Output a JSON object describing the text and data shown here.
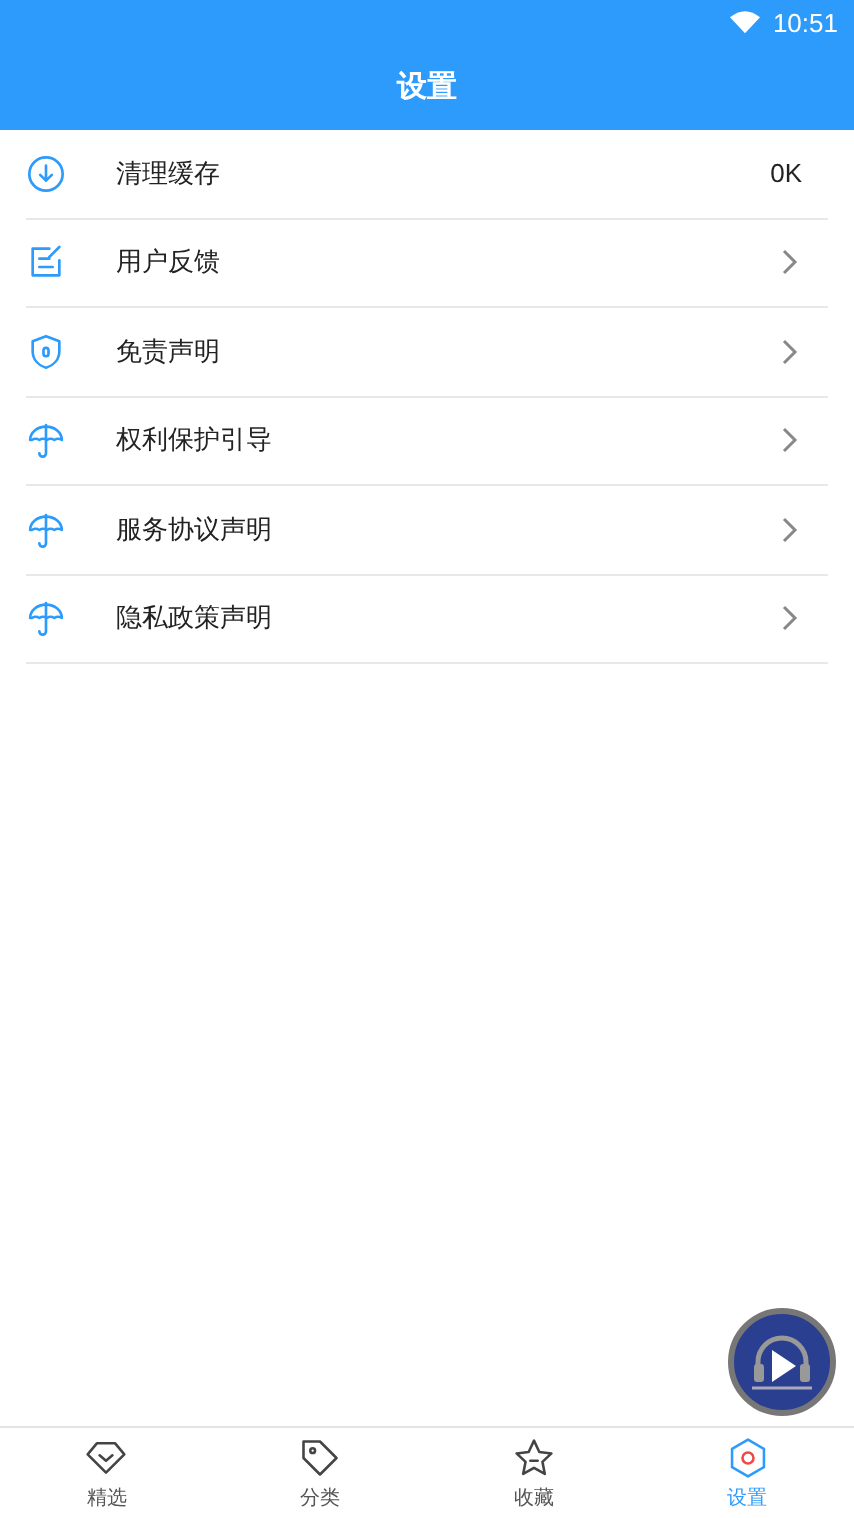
{
  "status_bar": {
    "time": "10:51"
  },
  "header": {
    "title": "设置"
  },
  "settings": [
    {
      "label": "清理缓存",
      "kind": "value",
      "value": "0K"
    },
    {
      "label": "用户反馈",
      "kind": "link"
    },
    {
      "label": "免责声明",
      "kind": "link"
    },
    {
      "label": "权利保护引导",
      "kind": "link"
    },
    {
      "label": "服务协议声明",
      "kind": "link"
    },
    {
      "label": "隐私政策声明",
      "kind": "link"
    }
  ],
  "tabs": [
    {
      "label": "精选",
      "selected": false
    },
    {
      "label": "分类",
      "selected": false
    },
    {
      "label": "收藏",
      "selected": false
    },
    {
      "label": "设置",
      "selected": true
    }
  ]
}
